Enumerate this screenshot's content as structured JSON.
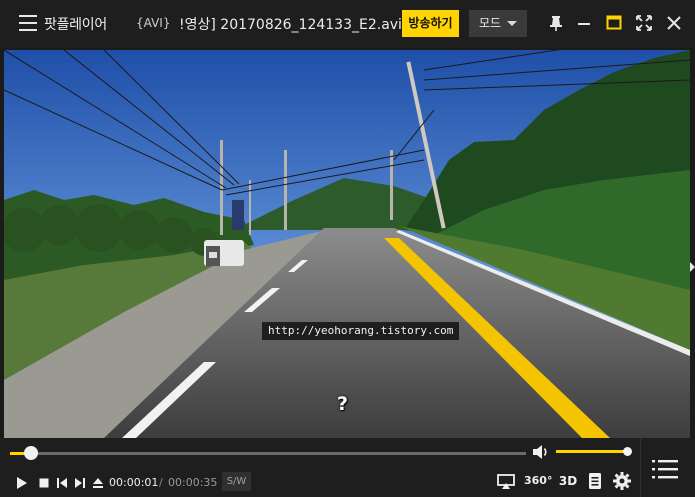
{
  "titlebar": {
    "app_name": "팟플레이어",
    "file_type": "{AVI}",
    "file_name": "!영상] 20170826_124133_E2.avi",
    "broadcast_label": "방송하기",
    "mode_label": "모드",
    "icons": [
      "menu-icon",
      "pin-icon",
      "minimize-icon",
      "maximize-icon",
      "fullscreen-icon",
      "close-icon"
    ]
  },
  "video": {
    "watermark": "http://yeohorang.tistory.com",
    "overlay_mark": "?"
  },
  "controls": {
    "progress": 0.04,
    "volume": 1.0,
    "time_current": "00:00:01",
    "time_separator": "/",
    "time_total": "00:00:35",
    "sw_label": "S/W",
    "label_360": "360°",
    "label_3d": "3D",
    "icons": [
      "play-icon",
      "stop-icon",
      "previous-icon",
      "next-icon",
      "eject-icon",
      "volume-icon",
      "screen-cast-icon",
      "360-icon",
      "3d-icon",
      "subtitle-icon",
      "settings-icon",
      "playlist-icon"
    ]
  },
  "colors": {
    "accent": "#ffd400",
    "background": "#1e1e1e",
    "track": "#6b6b6b"
  }
}
